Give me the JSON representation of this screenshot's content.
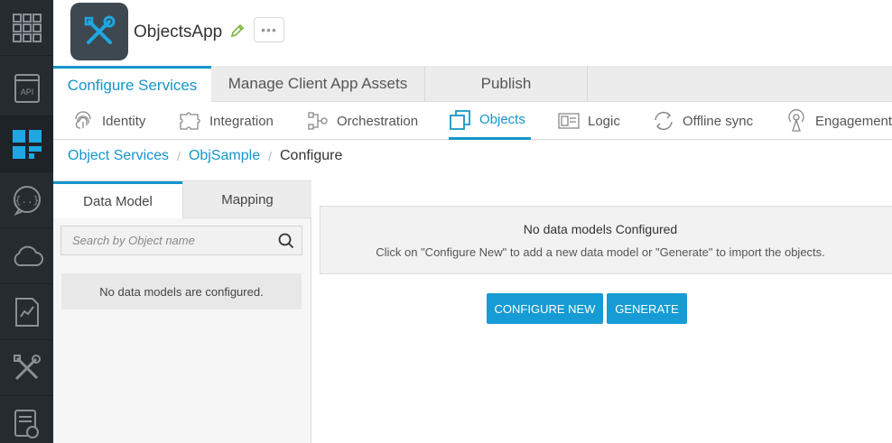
{
  "colors": {
    "accent": "#1595c9",
    "rail": "#262b30",
    "button": "#169bd5"
  },
  "rail": {
    "items": [
      {
        "icon": "grid-apps-icon"
      },
      {
        "icon": "api-icon"
      },
      {
        "icon": "dashboard-tiles-icon"
      },
      {
        "icon": "chat-bubble-icon"
      },
      {
        "icon": "cloud-icon"
      },
      {
        "icon": "analytics-doc-icon"
      },
      {
        "icon": "tools-icon"
      },
      {
        "icon": "report-icon"
      }
    ]
  },
  "header": {
    "app_name": "ObjectsApp",
    "edit_icon": "pencil-icon",
    "more_label": "•••"
  },
  "main_tabs": [
    {
      "label": "Configure Services",
      "active": true
    },
    {
      "label": "Manage Client App Assets",
      "active": false
    },
    {
      "label": "Publish",
      "active": false
    }
  ],
  "sub_tabs": [
    {
      "label": "Identity",
      "icon": "fingerprint-icon"
    },
    {
      "label": "Integration",
      "icon": "puzzle-icon"
    },
    {
      "label": "Orchestration",
      "icon": "flow-icon"
    },
    {
      "label": "Objects",
      "icon": "objects-icon",
      "active": true
    },
    {
      "label": "Logic",
      "icon": "logic-icon"
    },
    {
      "label": "Offline sync",
      "icon": "sync-icon"
    },
    {
      "label": "Engagement",
      "icon": "broadcast-icon"
    }
  ],
  "breadcrumb": {
    "items": [
      "Object Services",
      "ObjSample"
    ],
    "current": "Configure",
    "separator": "/"
  },
  "left_panel": {
    "tabs": [
      "Data Model",
      "Mapping"
    ],
    "search_placeholder": "Search by Object name",
    "empty_message": "No data models are configured."
  },
  "content": {
    "title": "No data models Configured",
    "message": "Click on \"Configure New\" to add a new data model or \"Generate\" to import the objects.",
    "configure_label": "CONFIGURE NEW",
    "generate_label": "GENERATE"
  }
}
